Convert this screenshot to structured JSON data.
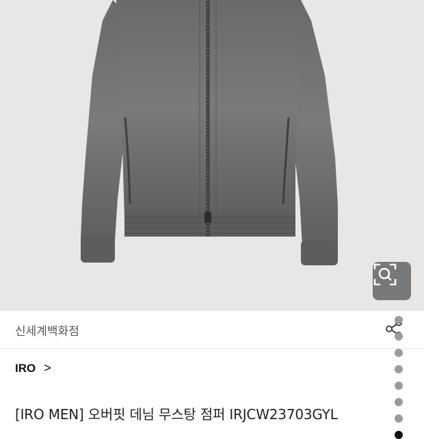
{
  "product": {
    "store_name": "신세계백화점",
    "brand": "IRO",
    "brand_chevron": ">",
    "title": "[IRO MEN] 오버핏 데님 무스탕 점퍼 IRJCW23703GYL"
  },
  "icons": {
    "lens": "lens-search-icon",
    "share": "share-icon",
    "chevron": "chevron-right-icon"
  },
  "gallery": {
    "image_subject": "gray washed denim zip-up bomber jacket",
    "page_count": 8,
    "active_index": 8
  },
  "colors": {
    "background": "#ffffff",
    "image_bg": "#e8e7e5",
    "jacket": "#6f6f6f",
    "active_dot": "#111111",
    "inactive_dot": "#9b9b9b"
  }
}
